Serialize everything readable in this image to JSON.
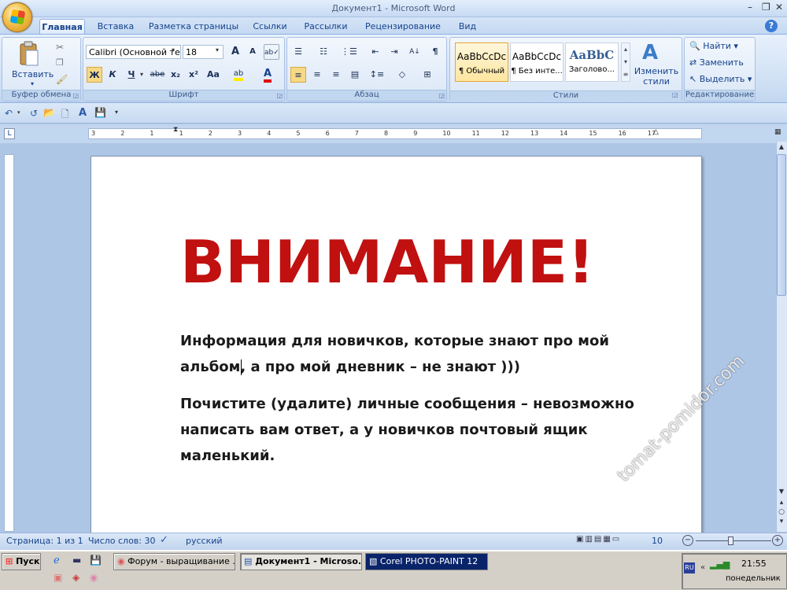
{
  "window": {
    "title": "Документ1 - Microsoft Word",
    "minimize": "–",
    "restore": "❐",
    "close": "✕",
    "help": "?"
  },
  "tabs": [
    "Главная",
    "Вставка",
    "Разметка страницы",
    "Ссылки",
    "Рассылки",
    "Рецензирование",
    "Вид"
  ],
  "ribbon": {
    "clipboard": {
      "label": "Буфер обмена",
      "paste": "Вставить"
    },
    "font": {
      "label": "Шрифт",
      "font_name": "Calibri (Основной те",
      "font_size": "18",
      "bold": "Ж",
      "italic": "К",
      "underline": "Ч",
      "strike": "abe",
      "subscript": "x₂",
      "superscript": "x²",
      "case": "Aa",
      "grow": "A",
      "shrink": "A"
    },
    "paragraph": {
      "label": "Абзац"
    },
    "styles": {
      "label": "Стили",
      "items": [
        {
          "preview": "AaBbCcDc",
          "name": "¶ Обычный"
        },
        {
          "preview": "AaBbCcDc",
          "name": "¶ Без инте..."
        },
        {
          "preview": "AaBbC",
          "name": "Заголово..."
        }
      ],
      "change": "Изменить стили"
    },
    "editing": {
      "label": "Редактирование",
      "find": "Найти",
      "replace": "Заменить",
      "select": "Выделить"
    }
  },
  "ruler": {
    "numbers": [
      "3",
      "2",
      "1",
      "1",
      "2",
      "3",
      "4",
      "5",
      "6",
      "7",
      "8",
      "9",
      "10",
      "11",
      "12",
      "13",
      "14",
      "15",
      "16",
      "17"
    ]
  },
  "document": {
    "headline": "ВНИМАНИЕ!",
    "para1_line1": "Информация для новичков, которые знают про мой",
    "para1_line2": "альбом, а про мой дневник – не знают )))",
    "para2_line1": "Почистите (удалите) личные сообщения – невозможно",
    "para2_line2": "написать вам ответ, а у новичков почтовый ящик",
    "para2_line3": "маленький."
  },
  "status": {
    "page": "Страница: 1 из 1",
    "words": "Число слов: 30",
    "language": "русский",
    "zoom": "10"
  },
  "taskbar": {
    "start": "Пуск",
    "buttons": [
      "Форум - выращивание ...",
      "Документ1 - Microso...",
      "Corel PHOTO-PAINT 12"
    ],
    "lang": "RU",
    "time": "21:55",
    "day": "понедельник"
  },
  "watermark": "tomat-pomidor.com",
  "colors": {
    "headline": "#c01010",
    "accent": "#15428b"
  }
}
